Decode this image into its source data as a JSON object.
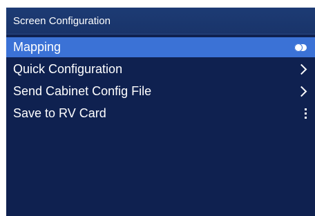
{
  "header": {
    "title": "Screen Configuration"
  },
  "menu": {
    "items": [
      {
        "label": "Mapping",
        "control": "toggle",
        "toggle_on": false,
        "selected": true
      },
      {
        "label": "Quick Configuration",
        "control": "chevron-right-icon",
        "selected": false
      },
      {
        "label": "Send Cabinet Config File",
        "control": "chevron-right-icon",
        "selected": false
      },
      {
        "label": "Save to RV Card",
        "control": "more-vertical-icon",
        "selected": false
      }
    ]
  },
  "colors": {
    "background": "#0f2150",
    "title_bar": "#1d3b74",
    "selected": "#3b72d6",
    "text": "#ffffff"
  }
}
